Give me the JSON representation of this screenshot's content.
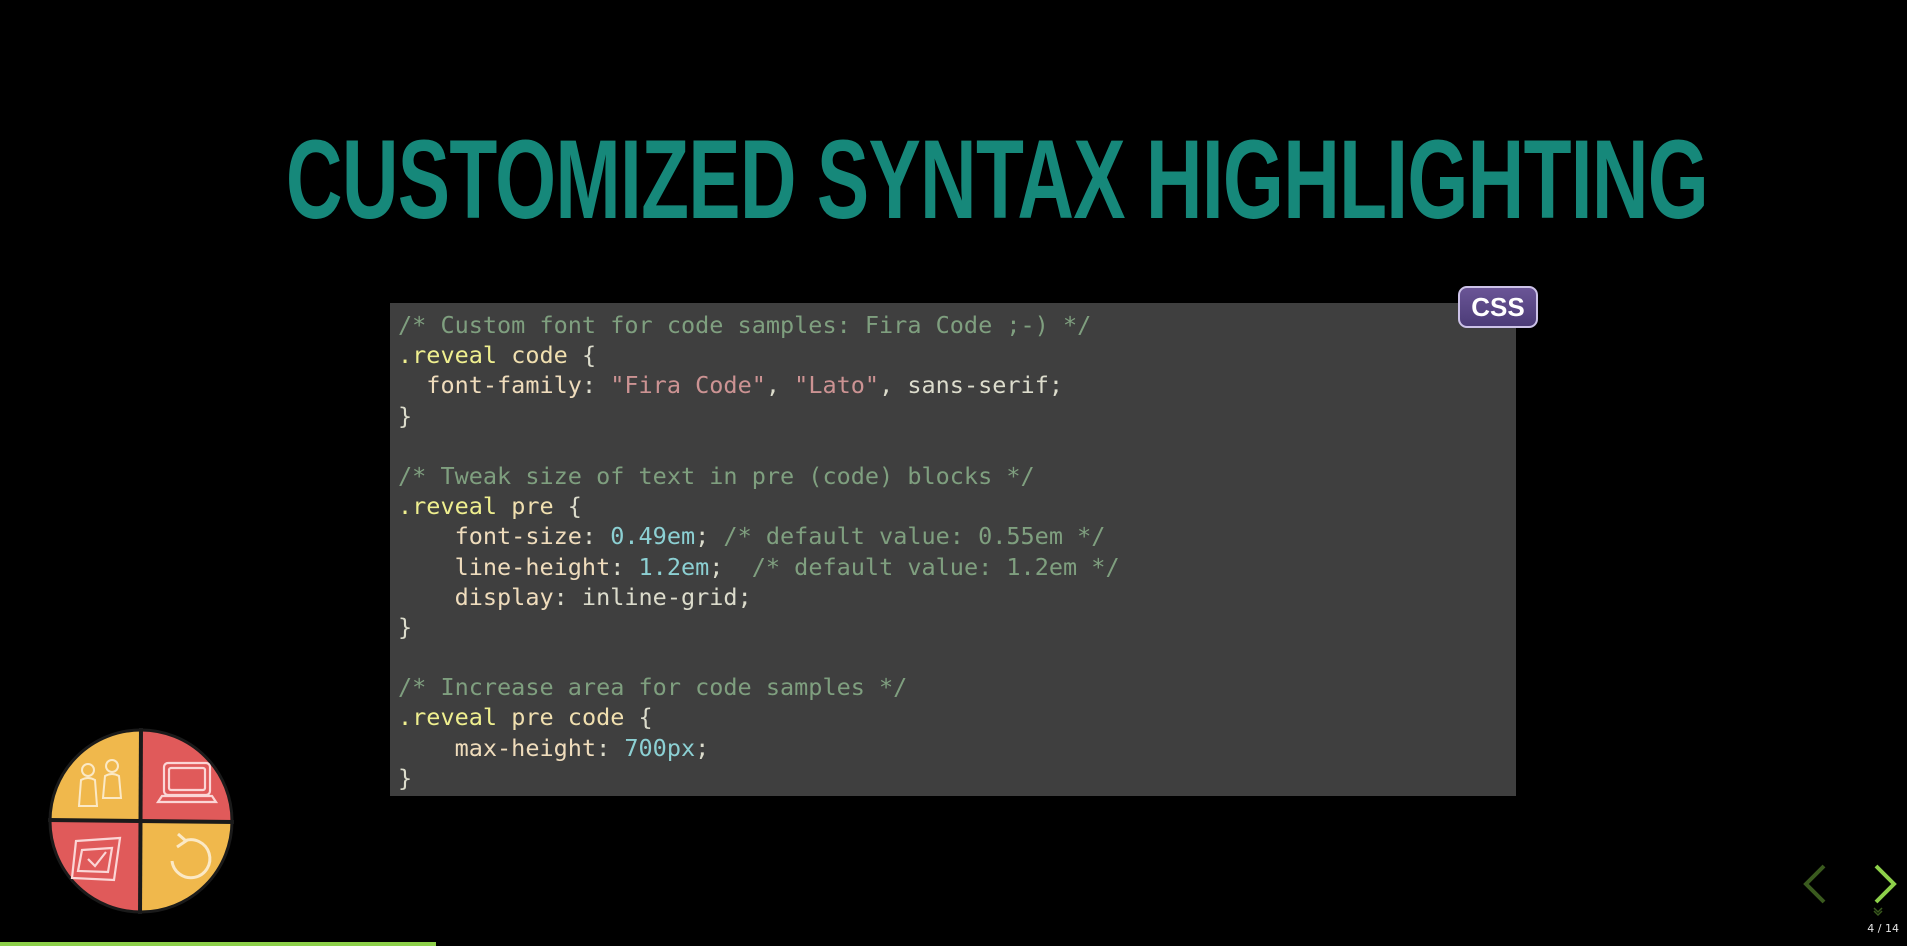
{
  "slide": {
    "title": "CUSTOMIZED SYNTAX HIGHLIGHTING",
    "code_language_badge": "CSS",
    "code_lines": [
      [
        {
          "t": "/* Custom font for code samples: Fira Code ;-) */",
          "c": "comment"
        }
      ],
      [
        {
          "t": ".reveal",
          "c": "selector"
        },
        {
          "t": " ",
          "c": "plain"
        },
        {
          "t": "code",
          "c": "ident"
        },
        {
          "t": " {",
          "c": "plain"
        }
      ],
      [
        {
          "t": "  ",
          "c": "plain"
        },
        {
          "t": "font-family",
          "c": "property"
        },
        {
          "t": ": ",
          "c": "plain"
        },
        {
          "t": "\"Fira Code\"",
          "c": "string"
        },
        {
          "t": ", ",
          "c": "plain"
        },
        {
          "t": "\"Lato\"",
          "c": "string"
        },
        {
          "t": ", sans-serif;",
          "c": "plain"
        }
      ],
      [
        {
          "t": "}",
          "c": "plain"
        }
      ],
      [
        {
          "t": "",
          "c": "plain"
        }
      ],
      [
        {
          "t": "/* Tweak size of text in pre (code) blocks */",
          "c": "comment"
        }
      ],
      [
        {
          "t": ".reveal",
          "c": "selector"
        },
        {
          "t": " ",
          "c": "plain"
        },
        {
          "t": "pre",
          "c": "ident"
        },
        {
          "t": " {",
          "c": "plain"
        }
      ],
      [
        {
          "t": "    ",
          "c": "plain"
        },
        {
          "t": "font-size",
          "c": "property"
        },
        {
          "t": ": ",
          "c": "plain"
        },
        {
          "t": "0.49em",
          "c": "number"
        },
        {
          "t": "; ",
          "c": "plain"
        },
        {
          "t": "/* default value: 0.55em */",
          "c": "comment"
        }
      ],
      [
        {
          "t": "    ",
          "c": "plain"
        },
        {
          "t": "line-height",
          "c": "property"
        },
        {
          "t": ": ",
          "c": "plain"
        },
        {
          "t": "1.2em",
          "c": "number"
        },
        {
          "t": ";  ",
          "c": "plain"
        },
        {
          "t": "/* default value: 1.2em */",
          "c": "comment"
        }
      ],
      [
        {
          "t": "    ",
          "c": "plain"
        },
        {
          "t": "display",
          "c": "property"
        },
        {
          "t": ": inline-grid;",
          "c": "plain"
        }
      ],
      [
        {
          "t": "}",
          "c": "plain"
        }
      ],
      [
        {
          "t": "",
          "c": "plain"
        }
      ],
      [
        {
          "t": "/* Increase area for code samples */",
          "c": "comment"
        }
      ],
      [
        {
          "t": ".reveal",
          "c": "selector"
        },
        {
          "t": " ",
          "c": "plain"
        },
        {
          "t": "pre code",
          "c": "ident"
        },
        {
          "t": " {",
          "c": "plain"
        }
      ],
      [
        {
          "t": "    ",
          "c": "plain"
        },
        {
          "t": "max-height",
          "c": "property"
        },
        {
          "t": ": ",
          "c": "plain"
        },
        {
          "t": "700px",
          "c": "number"
        },
        {
          "t": ";",
          "c": "plain"
        }
      ],
      [
        {
          "t": "}",
          "c": "plain"
        }
      ]
    ]
  },
  "logo": {
    "icons": [
      "people-icon",
      "monitor-icon",
      "checkbox-icon",
      "refresh-icon"
    ]
  },
  "navigation": {
    "prev_icon": "chevron-left-icon",
    "next_icon": "chevron-right-icon",
    "slide_number": "4 / 14",
    "current_slide": 4,
    "total_slides": 14,
    "progress": 0.2286
  },
  "colors": {
    "title": "#16887a",
    "code_background": "#3f3f3f",
    "progress": "#8dd04a",
    "badge": "#5a4786",
    "logo_yellow": "#f0b84c",
    "logo_red": "#e05a5a"
  }
}
